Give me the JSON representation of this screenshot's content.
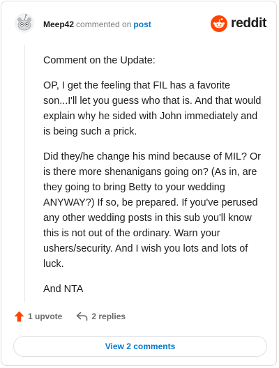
{
  "header": {
    "username": "Meep42",
    "action_text": "commented on",
    "post_link": "post",
    "brand": "reddit"
  },
  "comment": {
    "paragraphs": [
      "Comment on the Update:",
      "OP, I get the feeling that FIL has a favorite son...I'll let you guess who that is. And that would explain why he sided with John immediately and is being such a prick.",
      "Did they/he change his mind because of MIL? Or is there more shenanigans going on? (As in, are they going to bring Betty to your wedding ANYWAY?) If so, be prepared. If you've perused any other wedding posts in this sub you'll know this is not out of the ordinary. Warn your ushers/security. And I wish you lots and lots of luck.",
      "And NTA"
    ]
  },
  "actions": {
    "upvotes": "1 upvote",
    "replies": "2 replies"
  },
  "footer": {
    "view_comments": "View 2 comments"
  },
  "colors": {
    "accent": "#0079d3",
    "brand": "#ff4500",
    "upvote": "#ff4500"
  }
}
